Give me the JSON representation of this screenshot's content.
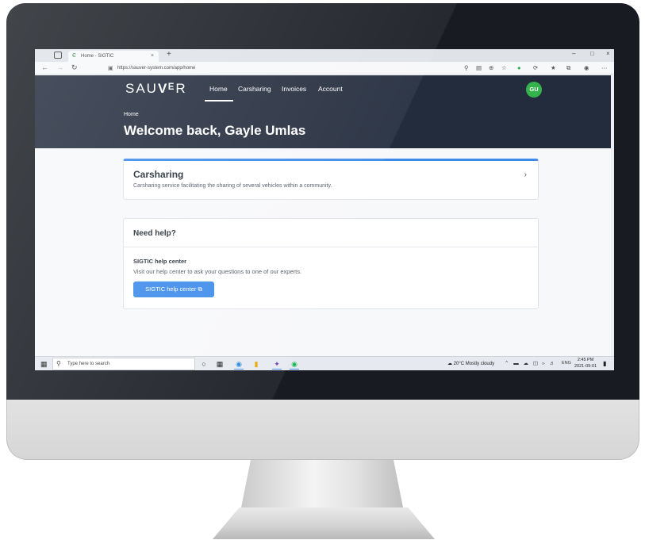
{
  "browser": {
    "tab_title": "Home - SIGTIC",
    "new_tab": "+",
    "url": "https://sauver-system.com/app/home",
    "window_controls": [
      "–",
      "□",
      "×"
    ]
  },
  "app": {
    "logo": {
      "a": "SAU",
      "b": "Vᴱ",
      "c": "R"
    },
    "nav": [
      "Home",
      "Carsharing",
      "Invoices",
      "Account"
    ],
    "avatar": "GU",
    "breadcrumb": "Home",
    "title": "Welcome back, Gayle Umlas"
  },
  "carsharing_card": {
    "title": "Carsharing",
    "description": "Carsharing service facilitating the sharing of several vehicles within a community."
  },
  "help_card": {
    "title": "Need help?",
    "subtitle": "SIGTIC help center",
    "description": "Visit our help center to ask your questions to one of our experts.",
    "button": "SIGTIC help center"
  },
  "taskbar": {
    "search_placeholder": "Type here to search",
    "weather": "20°C  Mostly cloudy",
    "lang": "ENG",
    "time": "2:45 PM",
    "date": "2021-09-01"
  },
  "colors": {
    "header_bg": "#232c3d",
    "accent": "#3d8bea",
    "avatar": "#34b24c"
  }
}
